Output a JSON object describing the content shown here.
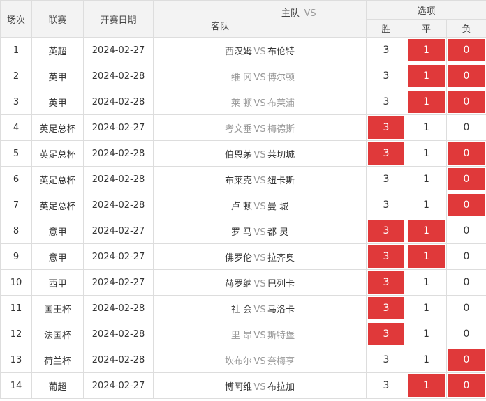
{
  "header": {
    "col_idx": "场次",
    "col_league": "联赛",
    "col_date": "开赛日期",
    "col_home": "主队",
    "col_vs": "VS",
    "col_away": "客队",
    "col_options": "选项",
    "opt_win": "胜",
    "opt_draw": "平",
    "opt_loss": "负"
  },
  "rows": [
    {
      "idx": "1",
      "league": "英超",
      "date": "2024-02-27",
      "home": "西汉姆",
      "home_gray": false,
      "vs": "VS",
      "away": "布伦特",
      "away_gray": false,
      "w": "3",
      "d": "1",
      "l": "0",
      "w_sel": false,
      "d_sel": true,
      "l_sel": true
    },
    {
      "idx": "2",
      "league": "英甲",
      "date": "2024-02-28",
      "home": "维 冈",
      "home_gray": true,
      "vs": "VS",
      "away": "博尔顿",
      "away_gray": true,
      "w": "3",
      "d": "1",
      "l": "0",
      "w_sel": false,
      "d_sel": true,
      "l_sel": true
    },
    {
      "idx": "3",
      "league": "英甲",
      "date": "2024-02-28",
      "home": "莱 顿",
      "home_gray": true,
      "vs": "VS",
      "away": "布莱浦",
      "away_gray": true,
      "w": "3",
      "d": "1",
      "l": "0",
      "w_sel": false,
      "d_sel": true,
      "l_sel": true
    },
    {
      "idx": "4",
      "league": "英足总杯",
      "date": "2024-02-27",
      "home": "考文垂",
      "home_gray": true,
      "vs": "VS",
      "away": "梅德斯",
      "away_gray": true,
      "w": "3",
      "d": "1",
      "l": "0",
      "w_sel": true,
      "d_sel": false,
      "l_sel": false
    },
    {
      "idx": "5",
      "league": "英足总杯",
      "date": "2024-02-28",
      "home": "伯恩茅",
      "home_gray": false,
      "vs": "VS",
      "away": "莱切城",
      "away_gray": false,
      "w": "3",
      "d": "1",
      "l": "0",
      "w_sel": true,
      "d_sel": false,
      "l_sel": true
    },
    {
      "idx": "6",
      "league": "英足总杯",
      "date": "2024-02-28",
      "home": "布莱克",
      "home_gray": false,
      "vs": "VS",
      "away": "纽卡斯",
      "away_gray": false,
      "w": "3",
      "d": "1",
      "l": "0",
      "w_sel": false,
      "d_sel": false,
      "l_sel": true
    },
    {
      "idx": "7",
      "league": "英足总杯",
      "date": "2024-02-28",
      "home": "卢 顿",
      "home_gray": false,
      "vs": "VS",
      "away": "曼 城",
      "away_gray": false,
      "w": "3",
      "d": "1",
      "l": "0",
      "w_sel": false,
      "d_sel": false,
      "l_sel": true
    },
    {
      "idx": "8",
      "league": "意甲",
      "date": "2024-02-27",
      "home": "罗 马",
      "home_gray": false,
      "vs": "VS",
      "away": "都 灵",
      "away_gray": false,
      "w": "3",
      "d": "1",
      "l": "0",
      "w_sel": true,
      "d_sel": true,
      "l_sel": false
    },
    {
      "idx": "9",
      "league": "意甲",
      "date": "2024-02-27",
      "home": "佛罗伦",
      "home_gray": false,
      "vs": "VS",
      "away": "拉齐奥",
      "away_gray": false,
      "w": "3",
      "d": "1",
      "l": "0",
      "w_sel": true,
      "d_sel": true,
      "l_sel": false
    },
    {
      "idx": "10",
      "league": "西甲",
      "date": "2024-02-27",
      "home": "赫罗纳",
      "home_gray": false,
      "vs": "VS",
      "away": "巴列卡",
      "away_gray": false,
      "w": "3",
      "d": "1",
      "l": "0",
      "w_sel": true,
      "d_sel": false,
      "l_sel": false
    },
    {
      "idx": "11",
      "league": "国王杯",
      "date": "2024-02-28",
      "home": "社 会",
      "home_gray": false,
      "vs": "VS",
      "away": "马洛卡",
      "away_gray": false,
      "w": "3",
      "d": "1",
      "l": "0",
      "w_sel": true,
      "d_sel": false,
      "l_sel": false
    },
    {
      "idx": "12",
      "league": "法国杯",
      "date": "2024-02-28",
      "home": "里 昂",
      "home_gray": true,
      "vs": "VS",
      "away": "斯特堡",
      "away_gray": true,
      "w": "3",
      "d": "1",
      "l": "0",
      "w_sel": true,
      "d_sel": false,
      "l_sel": false
    },
    {
      "idx": "13",
      "league": "荷兰杯",
      "date": "2024-02-28",
      "home": "坎布尔",
      "home_gray": true,
      "vs": "VS",
      "away": "奈梅亨",
      "away_gray": true,
      "w": "3",
      "d": "1",
      "l": "0",
      "w_sel": false,
      "d_sel": false,
      "l_sel": true
    },
    {
      "idx": "14",
      "league": "葡超",
      "date": "2024-02-27",
      "home": "博阿维",
      "home_gray": false,
      "vs": "VS",
      "away": "布拉加",
      "away_gray": false,
      "w": "3",
      "d": "1",
      "l": "0",
      "w_sel": false,
      "d_sel": true,
      "l_sel": true
    }
  ],
  "colors": {
    "selected": "#e0393a",
    "header_bg": "#f3f3f3",
    "muted": "#999999"
  }
}
